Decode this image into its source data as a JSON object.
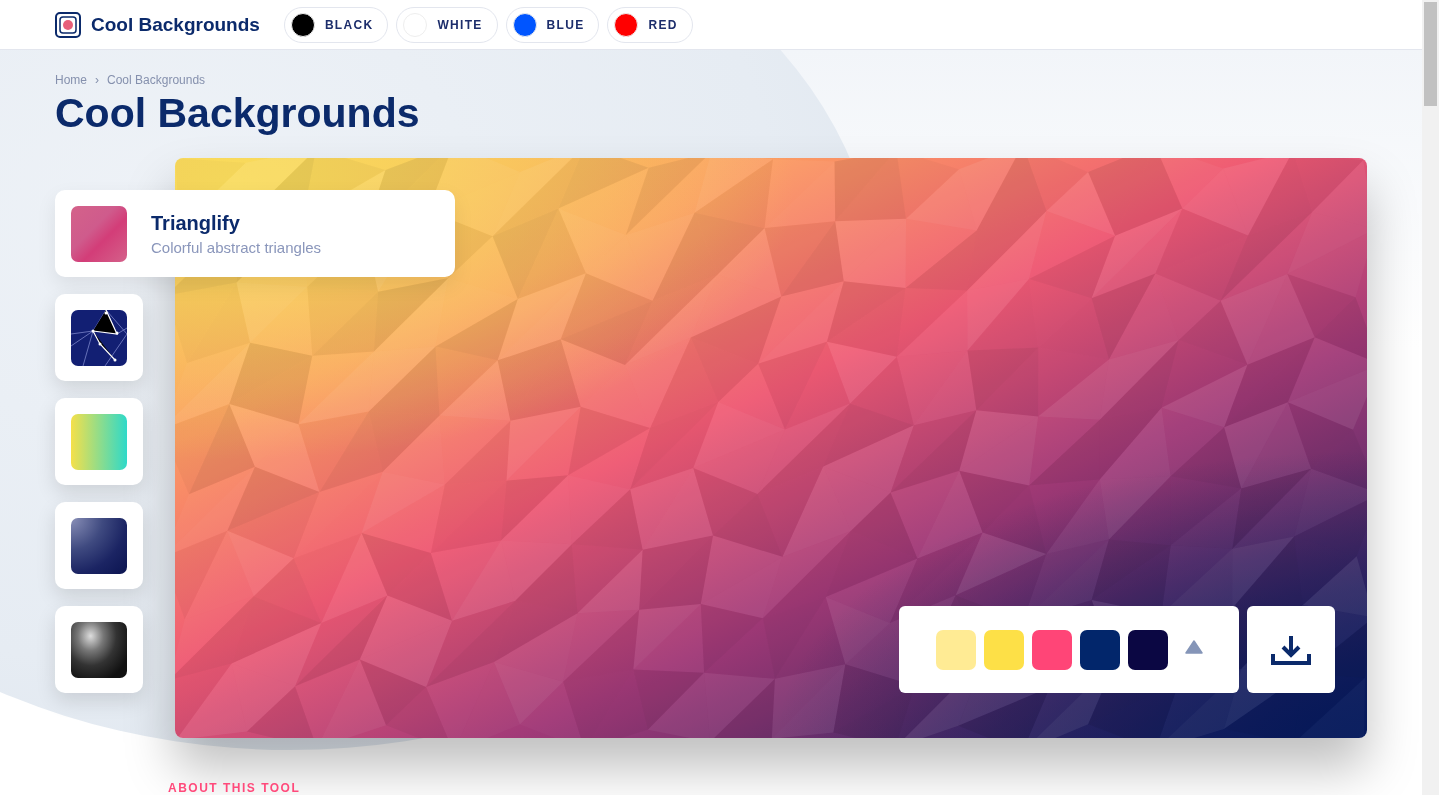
{
  "header": {
    "title": "Cool Backgrounds",
    "color_filters": [
      {
        "label": "BLACK",
        "color": "#000000"
      },
      {
        "label": "WHITE",
        "color": "#ffffff"
      },
      {
        "label": "BLUE",
        "color": "#0055ff"
      },
      {
        "label": "RED",
        "color": "#ff0000"
      }
    ]
  },
  "breadcrumb": {
    "items": [
      "Home",
      "Cool Backgrounds"
    ],
    "separator": "›"
  },
  "page_title": "Cool Backgrounds",
  "generators": [
    {
      "kind": "triangles",
      "selected": true,
      "name": "Trianglify",
      "description": "Colorful abstract triangles"
    },
    {
      "kind": "network",
      "selected": false
    },
    {
      "kind": "gradient",
      "selected": false
    },
    {
      "kind": "waves",
      "selected": false
    },
    {
      "kind": "noise",
      "selected": false
    }
  ],
  "palette": {
    "swatches": [
      {
        "color": "#ffeb94"
      },
      {
        "color": "#fde047"
      },
      {
        "color": "#ff4577"
      },
      {
        "color": "#02266b"
      },
      {
        "color": "#0b0743"
      }
    ],
    "expanded": false
  },
  "section_heading": "ABOUT THIS TOOL"
}
